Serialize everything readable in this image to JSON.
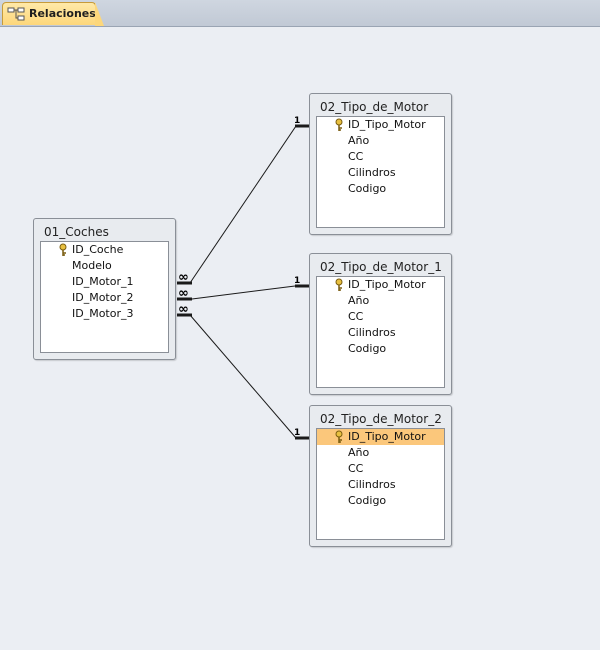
{
  "tab": {
    "label": "Relaciones",
    "icon": "relationships-icon"
  },
  "tables": {
    "coches": {
      "title": "01_Coches",
      "fields": [
        "ID_Coche",
        "Modelo",
        "ID_Motor_1",
        "ID_Motor_2",
        "ID_Motor_3"
      ],
      "primary_key": "ID_Coche"
    },
    "tipo_motor": {
      "title": "02_Tipo_de_Motor",
      "fields": [
        "ID_Tipo_Motor",
        "Año",
        "CC",
        "Cilindros",
        "Codigo"
      ],
      "primary_key": "ID_Tipo_Motor"
    },
    "tipo_motor_1": {
      "title": "02_Tipo_de_Motor_1",
      "fields": [
        "ID_Tipo_Motor",
        "Año",
        "CC",
        "Cilindros",
        "Codigo"
      ],
      "primary_key": "ID_Tipo_Motor"
    },
    "tipo_motor_2": {
      "title": "02_Tipo_de_Motor_2",
      "fields": [
        "ID_Tipo_Motor",
        "Año",
        "CC",
        "Cilindros",
        "Codigo"
      ],
      "primary_key": "ID_Tipo_Motor",
      "selected_field": "ID_Tipo_Motor"
    }
  },
  "relationships": [
    {
      "from": "ID_Motor_1",
      "to": "02_Tipo_de_Motor.ID_Tipo_Motor",
      "many_label": "∞",
      "one_label": "1"
    },
    {
      "from": "ID_Motor_2",
      "to": "02_Tipo_de_Motor_1.ID_Tipo_Motor",
      "many_label": "∞",
      "one_label": "1"
    },
    {
      "from": "ID_Motor_3",
      "to": "02_Tipo_de_Motor_2.ID_Tipo_Motor",
      "many_label": "∞",
      "one_label": "1"
    }
  ],
  "colors": {
    "tab": "#fdd77b",
    "selected_field": "#fbc77b",
    "canvas": "#ebeef3"
  }
}
